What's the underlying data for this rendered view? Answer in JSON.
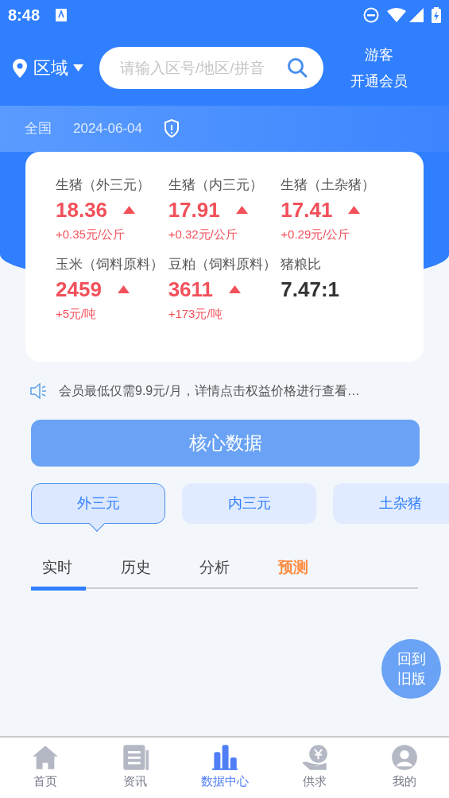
{
  "status_bar": {
    "time": "8:48"
  },
  "header": {
    "region": "区域",
    "search": {
      "placeholder": "请输入区号/地区/拼音"
    },
    "user": "游客",
    "member": "开通会员"
  },
  "summary": {
    "scope": "全国",
    "date": "2024-06-04"
  },
  "prices": [
    {
      "name": "生猪（外三元）",
      "value": "18.36",
      "change": "+0.35元/公斤",
      "kind": "rising"
    },
    {
      "name": "生猪（内三元）",
      "value": "17.91",
      "change": "+0.32元/公斤",
      "kind": "rising"
    },
    {
      "name": "生猪（土杂猪）",
      "value": "17.41",
      "change": "+0.29元/公斤",
      "kind": "rising"
    },
    {
      "name": "玉米（饲料原料）",
      "value": "2459",
      "change": "+5元/吨",
      "kind": "rising"
    },
    {
      "name": "豆粕（饲料原料）",
      "value": "3611",
      "change": "+173元/吨",
      "kind": "rising"
    },
    {
      "name": "猪粮比",
      "value": "7.47:1",
      "kind": "ratio"
    }
  ],
  "notice": "会员最低仅需9.9元/月，详情点击权益价格进行查看…",
  "core_button": "核心数据",
  "categories": [
    {
      "label": "外三元",
      "selected": true
    },
    {
      "label": "内三元",
      "selected": false
    },
    {
      "label": "土杂猪",
      "selected": false
    }
  ],
  "tabs": [
    {
      "label": "实时",
      "selected": true,
      "accent": false
    },
    {
      "label": "历史",
      "selected": false,
      "accent": false
    },
    {
      "label": "分析",
      "selected": false,
      "accent": false
    },
    {
      "label": "预测",
      "selected": false,
      "accent": true
    }
  ],
  "old_version_button": "回到旧版",
  "nav": [
    {
      "label": "首页",
      "kind": "home",
      "selected": false
    },
    {
      "label": "资讯",
      "kind": "news",
      "selected": false
    },
    {
      "label": "数据中心",
      "kind": "chart",
      "selected": true
    },
    {
      "label": "供求",
      "kind": "money",
      "selected": false
    },
    {
      "label": "我的",
      "kind": "user",
      "selected": false
    }
  ]
}
